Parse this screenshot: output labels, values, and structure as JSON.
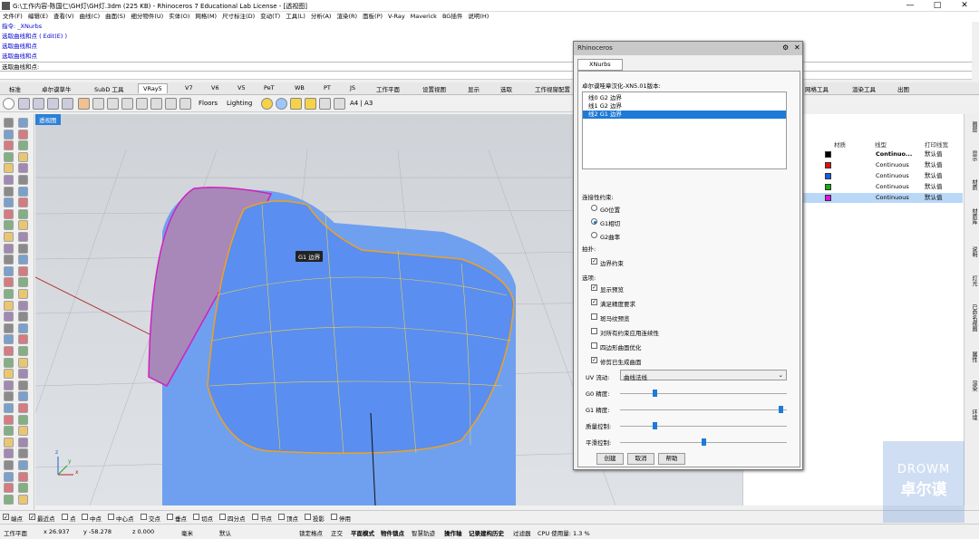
{
  "window": {
    "title": "G:\\工作内容-陈国仁\\GH灯\\GH灯.3dm (225 KB) - Rhinoceros 7 Educational Lab License - [透视图]",
    "min": "—",
    "max": "□",
    "close": "✕"
  },
  "menu": [
    "文件(F)",
    "编辑(E)",
    "查看(V)",
    "曲线(C)",
    "曲面(S)",
    "细分物件(U)",
    "实体(O)",
    "网格(M)",
    "尺寸标注(D)",
    "变动(T)",
    "工具(L)",
    "分析(A)",
    "渲染(R)",
    "面板(P)",
    "V-Ray",
    "Maverick",
    "BG插件",
    "说明(H)"
  ],
  "command": {
    "lines": [
      "指令: _XNurbs",
      "选取曲线和点 ( Edit(E) )",
      "选取曲线和点",
      "选取曲线和点"
    ],
    "prompt": "选取曲线和点:"
  },
  "tabs": [
    "标准",
    "卓尔谟草牛",
    "SubD 工具",
    "VRay5",
    "V7",
    "V6",
    "V5",
    "PeT",
    "WB",
    "PT",
    "JS",
    "工作平面",
    "设置视图",
    "显示",
    "选取",
    "工作视窗配置",
    "网格工具",
    "渲染工具",
    "出图"
  ],
  "toolbar": {
    "floors": "Floors",
    "lighting": "Lighting",
    "paper": "A4 | A3"
  },
  "viewport": {
    "label": "透视图",
    "tooltip": "G1 边界",
    "axis_x": "x",
    "axis_y": "y",
    "axis_z": "z"
  },
  "dialog": {
    "title": "Rhinoceros",
    "tab": "XNurbs",
    "version": "卓尔谟哇章汉化-XN5.01版本:",
    "list": [
      "线0  G2  边界",
      "线1  G2  边界",
      "线2  G1  边界"
    ],
    "continuity_label": "连接性约束:",
    "radios": [
      "G0位置",
      "G1相切",
      "G2曲率"
    ],
    "hold_label": "拍扑:",
    "boundary_cb": "边界约束",
    "options_label": "选项:",
    "options": [
      "显示预览",
      "满足精度要求",
      "斑马纹预览",
      "对所有约束应用连续性",
      "四边形曲面优化",
      "修剪已生成曲面"
    ],
    "uv_label": "UV 流动:",
    "uv_value": "曲线法线",
    "sliders": [
      {
        "label": "G0 精度:",
        "value": 0.2
      },
      {
        "label": "G1 精度:",
        "value": 0.97
      },
      {
        "label": "质量控制:",
        "value": 0.2
      },
      {
        "label": "平滑控制:",
        "value": 0.5
      }
    ],
    "buttons": [
      "创建",
      "取消",
      "帮助"
    ]
  },
  "layers": {
    "headers": [
      "材质",
      "线型",
      "打印线宽"
    ],
    "rows": [
      {
        "linetype": "Continuo...",
        "print": "默认值",
        "color": "#000000",
        "pc": "#000000"
      },
      {
        "linetype": "Continuous",
        "print": "默认值",
        "color": "#e01010",
        "pc": "#e01010"
      },
      {
        "linetype": "Continuous",
        "print": "默认值",
        "color": "#1060e0",
        "pc": "#1060e0"
      },
      {
        "linetype": "Continuous",
        "print": "默认值",
        "color": "#10b010",
        "pc": "#10b010"
      },
      {
        "linetype": "Continuous",
        "print": "默认值",
        "color": "#e010e0",
        "pc": "#e010e0"
      }
    ]
  },
  "righttabs": [
    "图层",
    "显示",
    "材质",
    "材质库",
    "说明",
    "灯光",
    "已命名视图",
    "属性",
    "渲染",
    "环境"
  ],
  "osnap": [
    "端点",
    "最近点",
    "点",
    "中点",
    "中心点",
    "交点",
    "垂点",
    "切点",
    "四分点",
    "节点",
    "顶点",
    "投影",
    "停用"
  ],
  "status": {
    "plane": "工作平面",
    "x": "x 26.937",
    "y": "y -58.278",
    "z": "z 0.000",
    "unit": "毫米",
    "layer": "默认",
    "items": [
      "锁定格点",
      "正交",
      "平面模式",
      "物件锁点",
      "智慧轨迹",
      "操作轴",
      "记录建构历史",
      "过滤器"
    ],
    "cpu": "CPU 使用量: 1.3 %"
  },
  "watermark": {
    "top": "DROWM",
    "bottom": "卓尔谟"
  }
}
